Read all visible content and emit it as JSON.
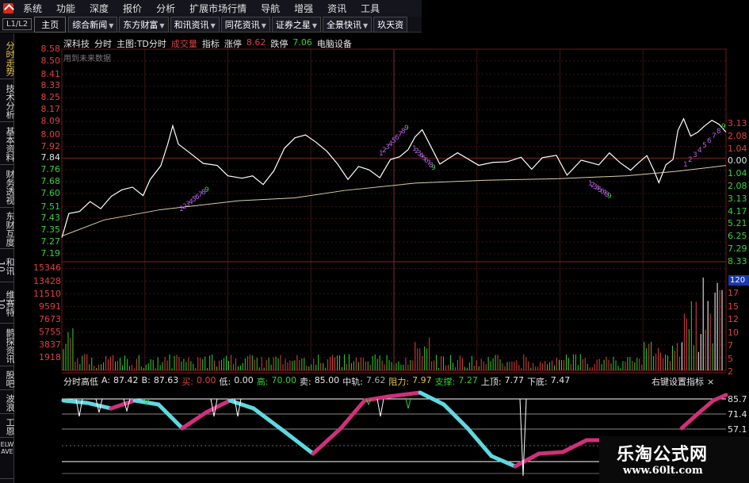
{
  "menubar": {
    "items": [
      "系统",
      "功能",
      "深度",
      "报价",
      "分析",
      "扩展市场行情",
      "导航",
      "增强",
      "资讯",
      "工具"
    ]
  },
  "tabbar": {
    "page_indicator": "L1/L2",
    "home": "主页",
    "news_tabs": [
      "综合新闻",
      "东方财富",
      "和讯资讯",
      "同花资讯",
      "证券之星",
      "全景快讯",
      "玖天资"
    ]
  },
  "left_tabs": [
    "分时走势",
    "技术分析",
    "基本资料",
    "财务透视",
    "东财互度",
    "和讯10",
    "维赛特10",
    "鹊探资讯",
    "股吧",
    "波浪",
    "工恩",
    "ELWAVE"
  ],
  "stock_header": {
    "name": "深科技",
    "mode": "分时",
    "main_chart": "主图:TD分时",
    "deal_label": "成交量",
    "indicator": "指标",
    "limit_up_label": "涨停",
    "limit_up": "8.62",
    "limit_down_label": "跌停",
    "limit_down": "7.06",
    "sector": "电脑设备"
  },
  "future_data_note": "用到未来数据",
  "price_axis": {
    "values": [
      "8.58",
      "8.50",
      "8.41",
      "8.33",
      "8.25",
      "8.17",
      "8.09",
      "8.00",
      "7.92",
      "7.84",
      "7.76",
      "7.68",
      "7.60",
      "7.51",
      "7.43",
      "7.35",
      "7.27",
      "7.19"
    ],
    "right_pct": [
      "3.13",
      "2.08",
      "1.04",
      "0.00",
      "1.04",
      "2.08",
      "3.13",
      "4.17",
      "5.21",
      "6.25",
      "7.29",
      "8.33"
    ],
    "pre_close": "7.84"
  },
  "volume_axis": {
    "values": [
      "15346",
      "13428",
      "11510",
      "9591",
      "7673",
      "5755",
      "3837",
      "1918"
    ],
    "right_partial": [
      "17",
      "15",
      "12",
      "10",
      "7",
      "5",
      "2"
    ],
    "badge": "120"
  },
  "td_markers": [
    "1",
    "2",
    "3",
    "4",
    "5",
    "6",
    "7",
    "8",
    "9"
  ],
  "indicator_header": {
    "name": "分时高低",
    "a_label": "A:",
    "a": "87.42",
    "b_label": "B:",
    "b": "87.63",
    "buy_label": "买:",
    "buy": "0.00",
    "low_label": "低:",
    "low": "0.00",
    "high_label": "高:",
    "high": "70.00",
    "sell_label": "卖:",
    "sell": "85.00",
    "mid_label": "中轨:",
    "mid": "7.62",
    "resist_label": "阻力:",
    "resist": "7.97",
    "support_label": "支撑:",
    "support": "7.27",
    "top_label": "上顶:",
    "top": "7.77",
    "bottom_label": "下底:",
    "bottom": "7.47",
    "right_menu": "右键设置指标",
    "close": "×"
  },
  "indicator_axis": [
    "85.7",
    "71.4",
    "57.1"
  ],
  "watermark": {
    "title": "乐淘公式网",
    "url": "www.60lt.com"
  },
  "colors": {
    "up": "#e04040",
    "down": "#2fd42f",
    "price_line": "#ffffff",
    "avg_line": "#d8d0a8",
    "grid": "#5a2020",
    "cyan_band": "#5fd8e0",
    "pink_band": "#d0307a",
    "td_purple": "#b060e0"
  }
}
